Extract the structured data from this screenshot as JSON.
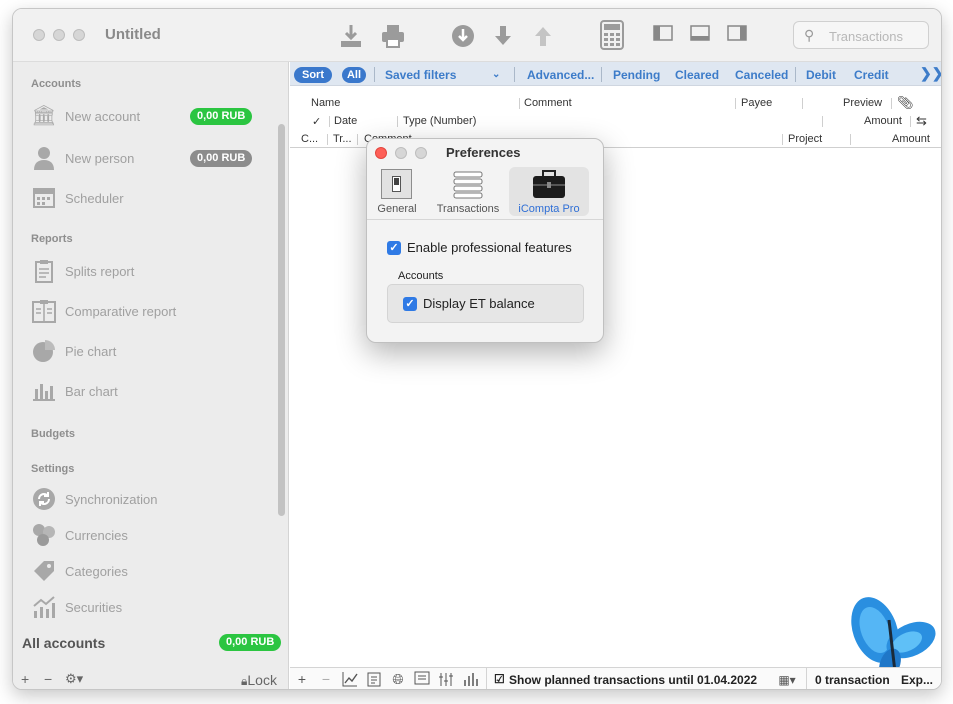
{
  "window": {
    "title": "Untitled"
  },
  "toolbar": {
    "icons": [
      "import-icon",
      "print-icon",
      "download-circle-icon",
      "arrow-down-icon",
      "arrow-up-icon",
      "calculator-icon",
      "left-panel-icon",
      "bottom-panel-icon",
      "right-panel-icon"
    ],
    "search_placeholder": "Transactions"
  },
  "sidebar": {
    "accounts_header": "Accounts",
    "new_account": "New account",
    "new_account_balance": "0,00 RUB",
    "new_person": "New person",
    "new_person_balance": "0,00 RUB",
    "scheduler": "Scheduler",
    "reports_header": "Reports",
    "splits_report": "Splits report",
    "comparative_report": "Comparative report",
    "pie_chart": "Pie chart",
    "bar_chart": "Bar chart",
    "budgets_header": "Budgets",
    "settings_header": "Settings",
    "synchronization": "Synchronization",
    "currencies": "Currencies",
    "categories": "Categories",
    "securities": "Securities",
    "all_accounts": "All accounts",
    "all_accounts_balance": "0,00 RUB",
    "lock": "Lock",
    "colors": {
      "green_pill": "#2bc541",
      "gray_pill": "#8c8c8c"
    }
  },
  "filterbar": {
    "sort": "Sort",
    "all": "All",
    "saved_filters": "Saved filters",
    "advanced": "Advanced...",
    "pending": "Pending",
    "cleared": "Cleared",
    "canceled": "Canceled",
    "debit": "Debit",
    "credit": "Credit",
    "accent": "#3a78cc"
  },
  "columns": {
    "name": "Name",
    "comment": "Comment",
    "payee": "Payee",
    "preview": "Preview",
    "check": "✓",
    "date": "Date",
    "type_number": "Type (Number)",
    "amount": "Amount",
    "c": "C...",
    "tr": "Tr...",
    "comment2": "Comment",
    "project": "Project",
    "amount2": "Amount"
  },
  "statusbar": {
    "planned_label": "Show planned transactions until 01.04.2022",
    "count": "0 transaction",
    "export": "Exp..."
  },
  "preferences": {
    "title": "Preferences",
    "tabs": [
      "General",
      "Transactions",
      "iCompta Pro"
    ],
    "active_tab": "iCompta Pro",
    "enable_pro": "Enable professional features",
    "accounts_label": "Accounts",
    "display_et": "Display ET balance"
  }
}
